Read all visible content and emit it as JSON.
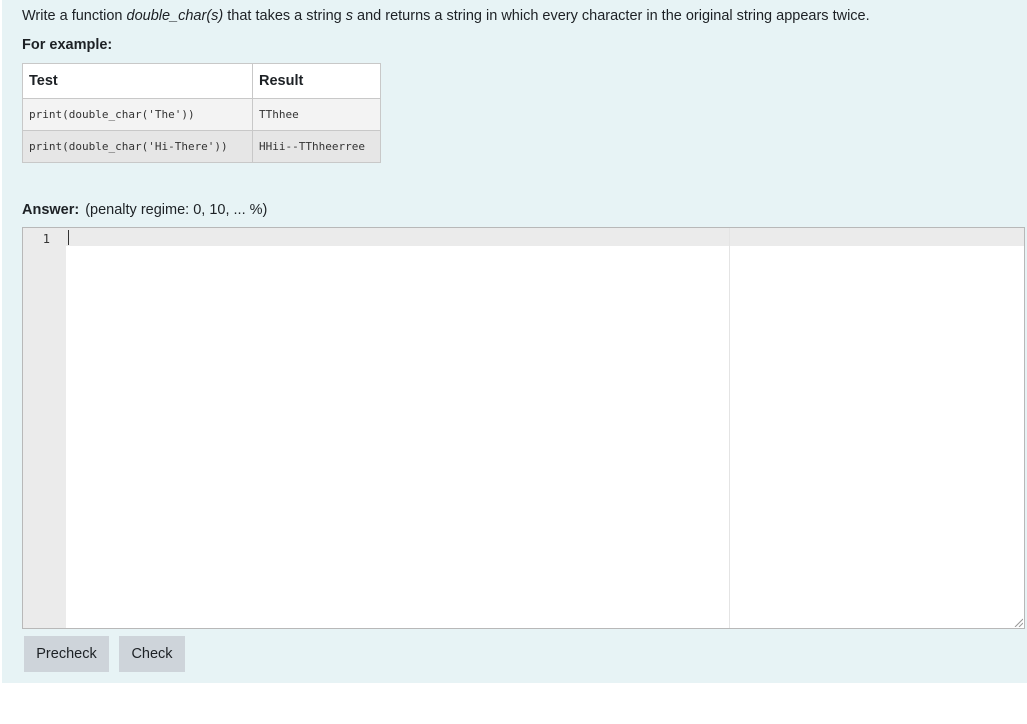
{
  "question": {
    "prompt_before": "Write a function ",
    "function_name": "double_char(s)",
    "prompt_middle": " that takes a string ",
    "param_name": "s",
    "prompt_after": " and returns a string in which every character in the original string appears twice.",
    "for_example_label": "For example:"
  },
  "examples": {
    "headers": [
      "Test",
      "Result"
    ],
    "rows": [
      {
        "test": "print(double_char('The'))",
        "result": "TThhee"
      },
      {
        "test": "print(double_char('Hi-There'))",
        "result": "HHii--TThheerree"
      }
    ]
  },
  "answer": {
    "label": "Answer:",
    "penalty": "(penalty regime: 0, 10, ... %)",
    "line_numbers": [
      "1"
    ],
    "code": ""
  },
  "buttons": {
    "precheck": "Precheck",
    "check": "Check"
  },
  "colors": {
    "panel_background": "#e7f3f5",
    "button_background": "#ced4da",
    "gutter_background": "#ebebeb"
  }
}
